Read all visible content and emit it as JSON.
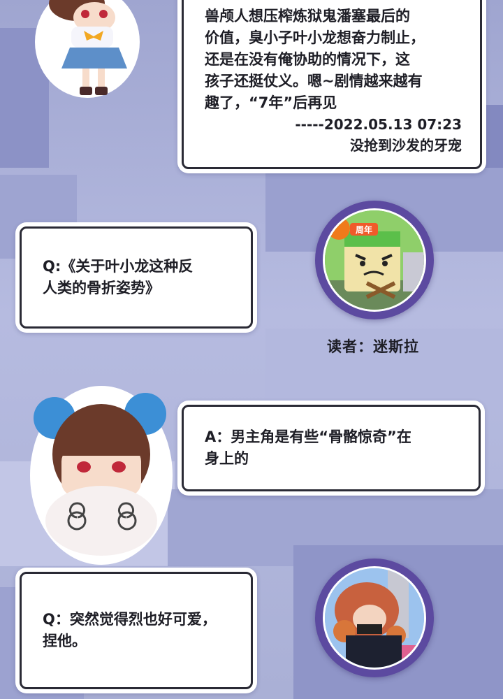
{
  "dialog": [
    {
      "id": "answer-1",
      "text": "兽颅人想压榨炼狱鬼潘塞最后的\n价值，臭小子叶小龙想奋力制止，\n还是在没有俺协助的情况下，这\n孩子还挺仗义。嗯~剧情越来越有\n趣了，“7年”后再见",
      "signature": "-----2022.05.13 07:23\n没抢到沙发的牙宠"
    },
    {
      "id": "question-1",
      "text": "Q:《关于叶小龙这种反\n人类的骨折姿势》"
    },
    {
      "id": "answer-2",
      "text": "A：男主角是有些“骨骼惊奇”在\n身上的"
    },
    {
      "id": "question-2",
      "text": "Q：突然觉得烈也好可爱，\n捏他。"
    }
  ],
  "reader_label": "读者：迷斯拉",
  "avatar_1_badge": "周年",
  "colors": {
    "background": "#aab0d6",
    "avatar_ring": "#5c4aa0",
    "card_border": "#2a2a35"
  }
}
